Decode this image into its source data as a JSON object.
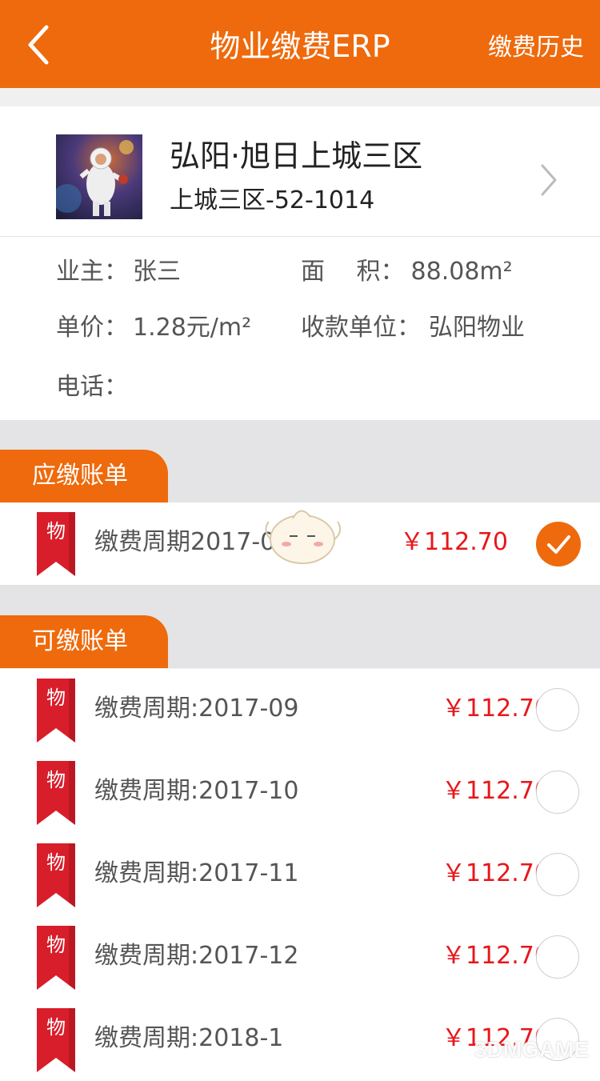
{
  "header": {
    "title": "物业缴费ERP",
    "right_action": "缴费历史",
    "back_icon": "back-chevron-icon",
    "background": "#ee6a0c"
  },
  "property": {
    "name": "弘阳·旭日上城三区",
    "unit": "上城三区-52-1014",
    "avatar_icon": "astronaut-photo"
  },
  "info": {
    "owner_label": "业主：",
    "owner_value": "张三",
    "area_label": "面　 积：",
    "area_value": "88.08m²",
    "price_label": "单价：",
    "price_value": "1.28元/m²",
    "payee_label": "收款单位：",
    "payee_value": "弘阳物业",
    "phone_label": "电话：",
    "phone_value": ""
  },
  "due_section": {
    "title": "应缴账单",
    "items": [
      {
        "tag": "物",
        "period": "缴费周期2017-08",
        "amount": "￥112.70",
        "checked": true
      }
    ]
  },
  "payable_section": {
    "title": "可缴账单",
    "items": [
      {
        "tag": "物",
        "period": "缴费周期:2017-09",
        "amount": "￥112.70",
        "checked": false
      },
      {
        "tag": "物",
        "period": "缴费周期:2017-10",
        "amount": "￥112.70",
        "checked": false
      },
      {
        "tag": "物",
        "period": "缴费周期:2017-11",
        "amount": "￥112.70",
        "checked": false
      },
      {
        "tag": "物",
        "period": "缴费周期:2017-12",
        "amount": "￥112.70",
        "checked": false
      },
      {
        "tag": "物",
        "period": "缴费周期:2018-1",
        "amount": "￥112.70",
        "checked": false
      }
    ]
  },
  "watermark": "3DMGAME",
  "colors": {
    "accent": "#ee6a0c",
    "amount": "#e8161a",
    "ribbon": "#d81e2b"
  }
}
